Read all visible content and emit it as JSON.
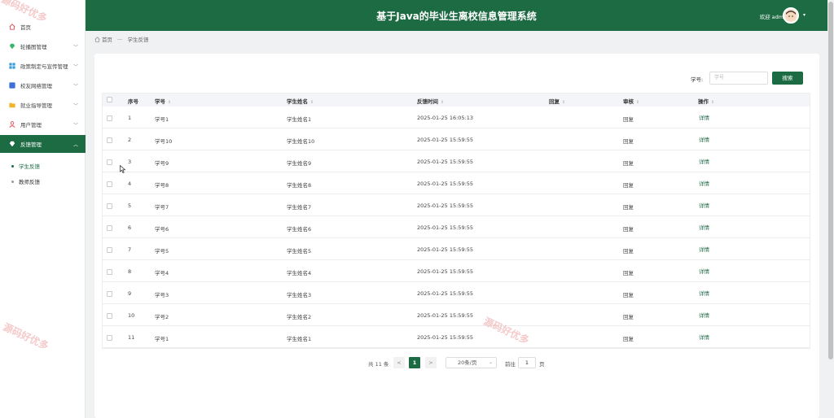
{
  "header": {
    "title": "基于Java的毕业生离校信息管理系统",
    "welcome": "欢迎 admin"
  },
  "sidebar": {
    "items": [
      {
        "label": "首页",
        "icon": "home-icon",
        "color": "#e0525c"
      },
      {
        "label": "轮播图管理",
        "icon": "gem-icon",
        "color": "#3db46d"
      },
      {
        "label": "政策制定与宣传管理",
        "icon": "grid-icon",
        "color": "#3a9bdc"
      },
      {
        "label": "校友网络管理",
        "icon": "square-icon",
        "color": "#3e6fd8"
      },
      {
        "label": "就业指导管理",
        "icon": "folder-icon",
        "color": "#f0b429"
      },
      {
        "label": "用户管理",
        "icon": "user-icon",
        "color": "#e0525c"
      },
      {
        "label": "反馈管理",
        "icon": "gem-icon",
        "color": "#ffffff"
      }
    ],
    "sub_items": [
      {
        "label": "学生反馈"
      },
      {
        "label": "教师反馈"
      }
    ]
  },
  "breadcrumb": {
    "home": "首页",
    "current": "学生反馈"
  },
  "search": {
    "label": "学号:",
    "placeholder": "学号",
    "button": "搜索"
  },
  "table": {
    "headers": [
      "序号",
      "学号",
      "学生姓名",
      "反馈时间",
      "回复",
      "审核",
      "操作"
    ],
    "rows": [
      {
        "no": "1",
        "id": "学号1",
        "name": "学生姓名1",
        "time": "2025-01-25 16:05:13",
        "reply": "",
        "audit": "回复",
        "action": "详情"
      },
      {
        "no": "2",
        "id": "学号10",
        "name": "学生姓名10",
        "time": "2025-01-25 15:59:55",
        "reply": "",
        "audit": "回复",
        "action": "详情"
      },
      {
        "no": "3",
        "id": "学号9",
        "name": "学生姓名9",
        "time": "2025-01-25 15:59:55",
        "reply": "",
        "audit": "回复",
        "action": "详情"
      },
      {
        "no": "4",
        "id": "学号8",
        "name": "学生姓名8",
        "time": "2025-01-25 15:59:55",
        "reply": "",
        "audit": "回复",
        "action": "详情"
      },
      {
        "no": "5",
        "id": "学号7",
        "name": "学生姓名7",
        "time": "2025-01-25 15:59:55",
        "reply": "",
        "audit": "回复",
        "action": "详情"
      },
      {
        "no": "6",
        "id": "学号6",
        "name": "学生姓名6",
        "time": "2025-01-25 15:59:55",
        "reply": "",
        "audit": "回复",
        "action": "详情"
      },
      {
        "no": "7",
        "id": "学号5",
        "name": "学生姓名5",
        "time": "2025-01-25 15:59:55",
        "reply": "",
        "audit": "回复",
        "action": "详情"
      },
      {
        "no": "8",
        "id": "学号4",
        "name": "学生姓名4",
        "time": "2025-01-25 15:59:55",
        "reply": "",
        "audit": "回复",
        "action": "详情"
      },
      {
        "no": "9",
        "id": "学号3",
        "name": "学生姓名3",
        "time": "2025-01-25 15:59:55",
        "reply": "",
        "audit": "回复",
        "action": "详情"
      },
      {
        "no": "10",
        "id": "学号2",
        "name": "学生姓名2",
        "time": "2025-01-25 15:59:55",
        "reply": "",
        "audit": "回复",
        "action": "详情"
      },
      {
        "no": "11",
        "id": "学号1",
        "name": "学生姓名1",
        "time": "2025-01-25 15:59:55",
        "reply": "",
        "audit": "回复",
        "action": "详情"
      }
    ]
  },
  "pagination": {
    "total": "共 11 条",
    "prev": "<",
    "current_page": "1",
    "next": ">",
    "page_size": "20条/页",
    "goto_label": "前往",
    "goto_value": "1",
    "goto_suffix": "页"
  },
  "watermark": "源码好优多",
  "colors": {
    "primary": "#1d6b43",
    "watermark": "#dc3c3c"
  }
}
